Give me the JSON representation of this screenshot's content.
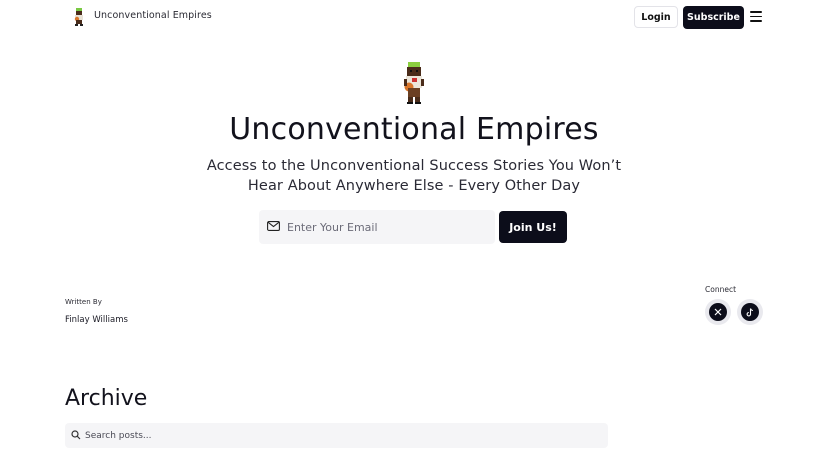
{
  "header": {
    "brand_name": "Unconventional Empires",
    "login_label": "Login",
    "subscribe_label": "Subscribe"
  },
  "hero": {
    "title": "Unconventional Empires",
    "subtitle": "Access to the Unconventional Success Stories You Won’t Hear About Anywhere Else - Every Other Day",
    "email_placeholder": "Enter Your Email",
    "join_label": "Join Us!"
  },
  "author": {
    "label": "Written By",
    "name": "Finlay Williams"
  },
  "connect": {
    "label": "Connect",
    "icons": [
      "x-icon",
      "tiktok-icon"
    ]
  },
  "archive": {
    "title": "Archive",
    "search_placeholder": "Search posts..."
  },
  "colors": {
    "primary_dark": "#0c0d1a",
    "input_bg": "#f5f5f7"
  }
}
